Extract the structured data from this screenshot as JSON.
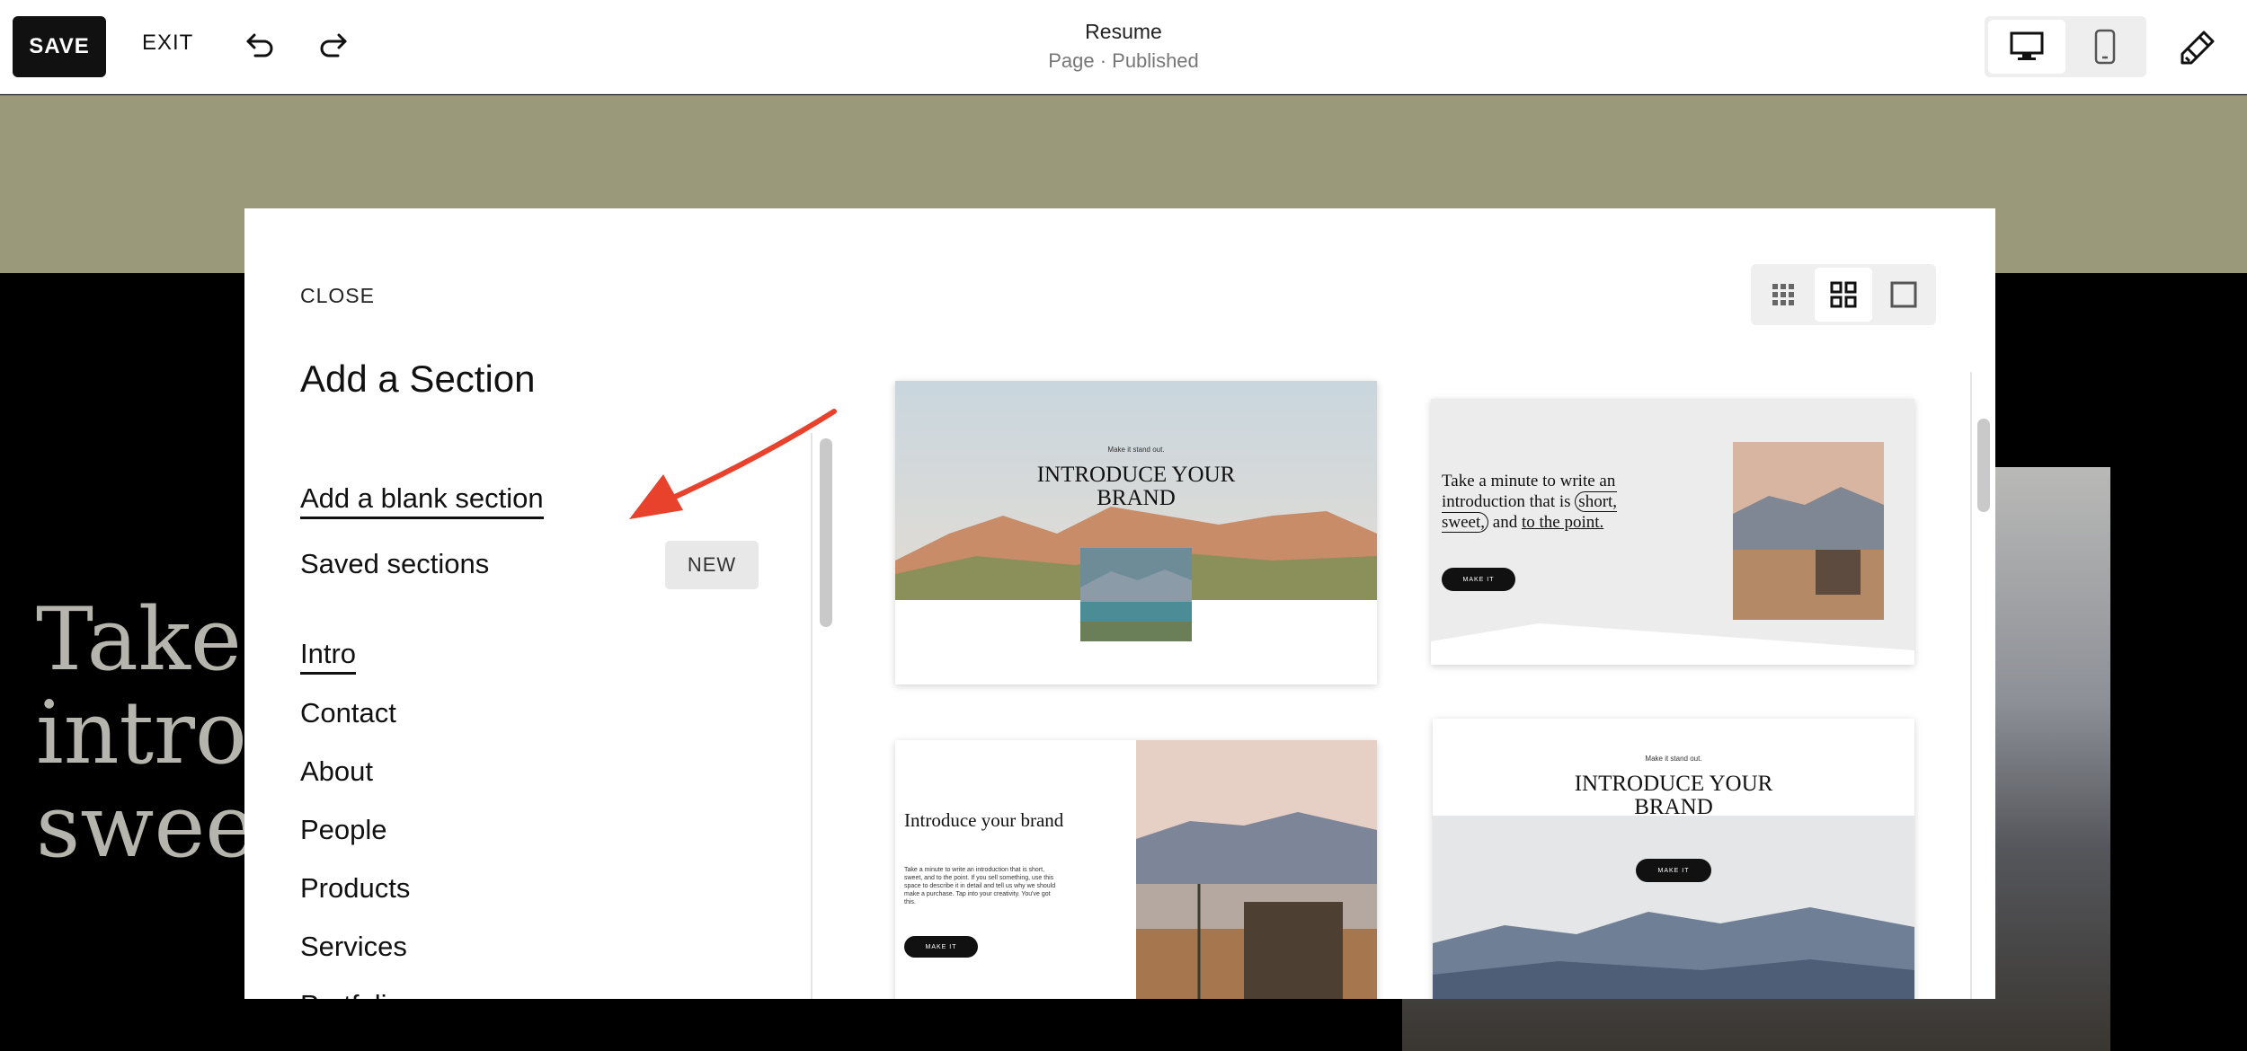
{
  "topbar": {
    "save_label": "SAVE",
    "exit_label": "EXIT",
    "page_title": "Resume",
    "page_status": "Page · Published"
  },
  "background": {
    "hero_text": "Take a\nintroc\nsweet"
  },
  "modal": {
    "close_label": "CLOSE",
    "title": "Add a Section",
    "blank_section_label": "Add a blank section",
    "saved_sections_label": "Saved sections",
    "new_badge": "NEW",
    "categories": [
      "Intro",
      "Contact",
      "About",
      "People",
      "Products",
      "Services",
      "Portfolio"
    ],
    "active_category": "Intro"
  },
  "templates": {
    "t1": {
      "kicker": "Make it stand out.",
      "heading": "INTRODUCE YOUR BRAND"
    },
    "t2": {
      "text_a": "Take a minute to write an introduction that is",
      "text_b": "short, sweet,",
      "text_c": "and",
      "text_d": "to the point.",
      "button": "MAKE IT"
    },
    "t3": {
      "heading": "Introduce your brand",
      "body": "Take a minute to write an introduction that is short, sweet, and to the point. If you sell something, use this space to describe it in detail and tell us why we should make a purchase. Tap into your creativity. You've got this.",
      "button": "MAKE IT"
    },
    "t4": {
      "kicker": "Make it stand out.",
      "heading": "INTRODUCE YOUR BRAND",
      "button": "MAKE IT"
    }
  },
  "icons": [
    "undo-icon",
    "redo-icon",
    "desktop-icon",
    "mobile-icon",
    "paintbrush-icon",
    "grid-small-icon",
    "grid-medium-icon",
    "grid-large-icon",
    "arrow-annotation-icon"
  ],
  "colors": {
    "accent_arrow": "#e8412c",
    "topbar_button": "#111111",
    "background_band": "#9a9a7a"
  }
}
